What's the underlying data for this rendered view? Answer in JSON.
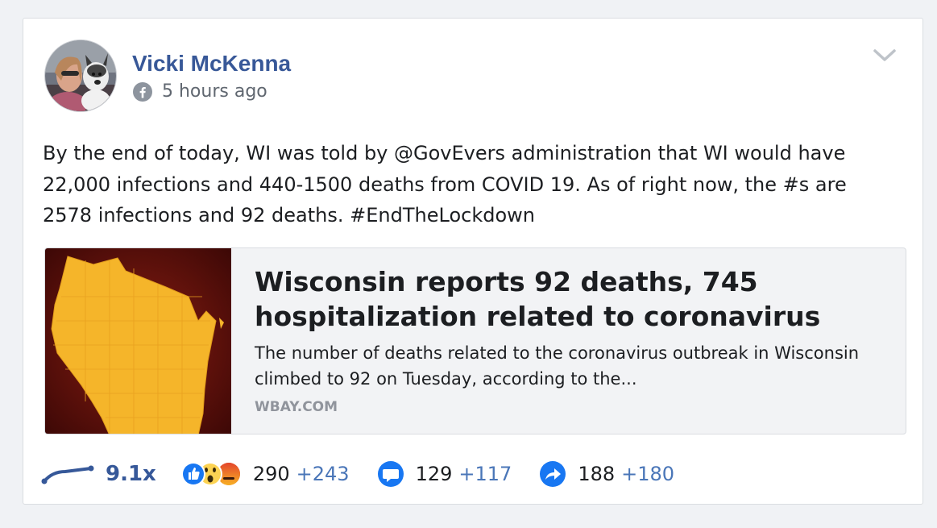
{
  "post": {
    "author": "Vicki McKenna",
    "time": "5 hours ago",
    "body": "By the end of today, WI was told by @GovEvers administration that WI would have 22,000 infections and 440-1500 deaths from COVID 19. As of right now, the #s are 2578 infections and 92 deaths. #EndTheLockdown"
  },
  "link": {
    "title": "Wisconsin reports 92 deaths, 745 hospitalization related to coronavirus",
    "description": "The number of deaths related to the coronavirus outbreak in Wisconsin climbed to 92 on Tuesday, according to the...",
    "domain": "WBAY.COM"
  },
  "stats": {
    "multiplier": "9.1x",
    "reactions": "290",
    "reactions_delta": "+243",
    "comments": "129",
    "comments_delta": "+117",
    "shares": "188",
    "shares_delta": "+180"
  },
  "colors": {
    "author": "#385898",
    "delta": "#4a76b8",
    "like": "#1877f2",
    "map_fill": "#f5b52a",
    "map_bg": "#5a0c0a"
  },
  "icons": [
    "facebook-icon",
    "chevron-down-icon",
    "trend-line-icon",
    "like-icon",
    "wow-icon",
    "angry-icon",
    "comment-icon",
    "share-icon"
  ]
}
